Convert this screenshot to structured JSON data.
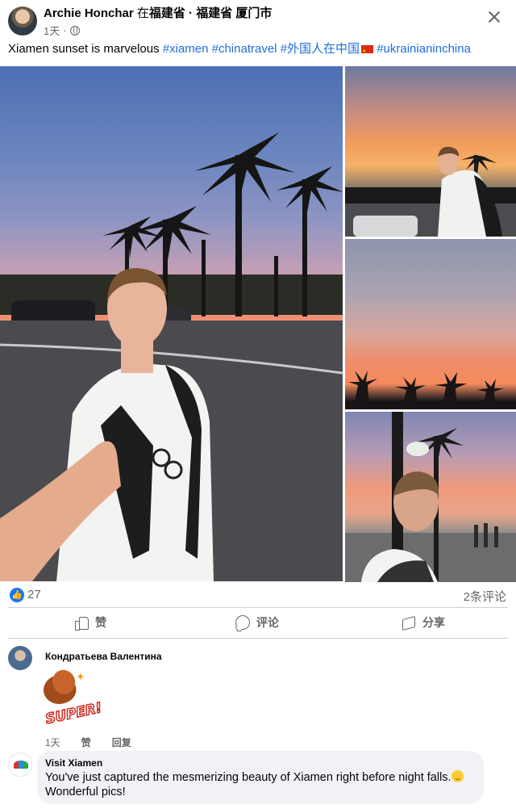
{
  "post": {
    "author": "Archie Honchar",
    "location_prefix": "在",
    "location": "福建省 · 福建省 厦门市",
    "time": "1天",
    "caption_text": "Xiamen sunset is marvelous ",
    "hashtags": [
      "#xiamen",
      "#chinatravel",
      "#外国人在中国",
      "#ukrainianinchina"
    ],
    "more_icon": "close-icon"
  },
  "reactions": {
    "like_count": "27",
    "comment_count": "2条评论"
  },
  "actions": {
    "like": "赞",
    "comment": "评论",
    "share": "分享"
  },
  "comments": [
    {
      "author": "Кондратьева Валентина",
      "sticker_text": "SUPER!",
      "time": "1天",
      "like": "赞",
      "reply": "回复"
    },
    {
      "author": "Visit Xiamen",
      "text": "You've just captured the mesmerizing beauty of Xiamen right before night falls.",
      "text2": "Wonderful pics!"
    }
  ],
  "colors": {
    "link": "#216fdb",
    "like_blue": "#1877f2",
    "secondary_text": "#65676b"
  }
}
